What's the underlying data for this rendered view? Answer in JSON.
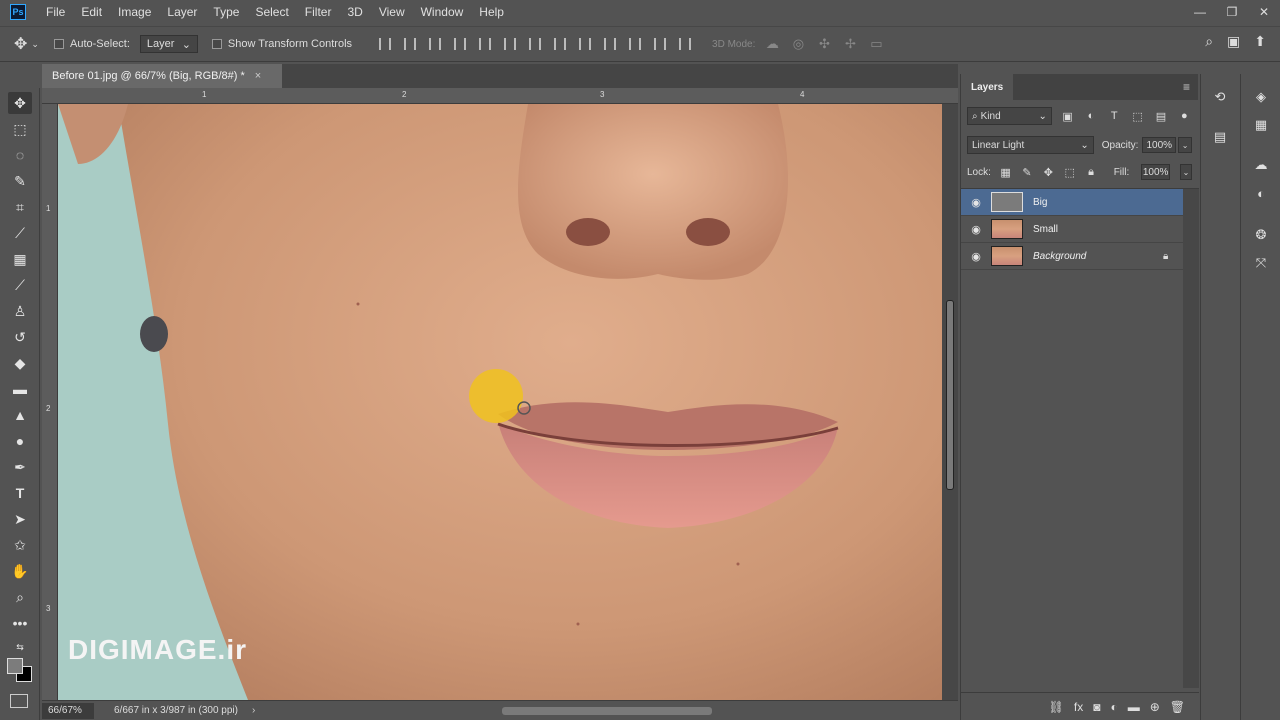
{
  "app": {
    "logo": "Ps"
  },
  "menu": [
    "File",
    "Edit",
    "Image",
    "Layer",
    "Type",
    "Select",
    "Filter",
    "3D",
    "View",
    "Window",
    "Help"
  ],
  "window_controls": {
    "minimize": "—",
    "restore": "❐",
    "close": "✕"
  },
  "options_bar": {
    "auto_select_label": "Auto-Select:",
    "auto_select_value": "Layer",
    "show_transform_label": "Show Transform Controls",
    "mode_3d_label": "3D Mode:"
  },
  "document": {
    "tab_title": "Before 01.jpg @ 66/7% (Big, RGB/8#) *",
    "close": "×",
    "ruler_top_ticks": [
      "1",
      "2",
      "3",
      "4"
    ],
    "ruler_left_ticks": [
      "1",
      "2",
      "3"
    ],
    "watermark": "DIGIMAGE.ir"
  },
  "status": {
    "zoom": "66/67%",
    "doc_size": "6/667 in x 3/987 in (300 ppi)",
    "arrow": "›"
  },
  "layers_panel": {
    "tab": "Layers",
    "filter_kind": "Kind",
    "blend_mode": "Linear Light",
    "opacity_label": "Opacity:",
    "opacity_value": "100%",
    "lock_label": "Lock:",
    "fill_label": "Fill:",
    "fill_value": "100%",
    "layers": [
      {
        "name": "Big",
        "selected": true,
        "thumb": "gray",
        "locked": false,
        "italic": false
      },
      {
        "name": "Small",
        "selected": false,
        "thumb": "face",
        "locked": false,
        "italic": false
      },
      {
        "name": "Background",
        "selected": false,
        "thumb": "face",
        "locked": true,
        "italic": true
      }
    ]
  },
  "colors": {
    "ui_bg": "#535353",
    "selected_layer": "#4c6a92",
    "brush_cursor": "#f0c21e",
    "backdrop": "#a9ccc5"
  }
}
